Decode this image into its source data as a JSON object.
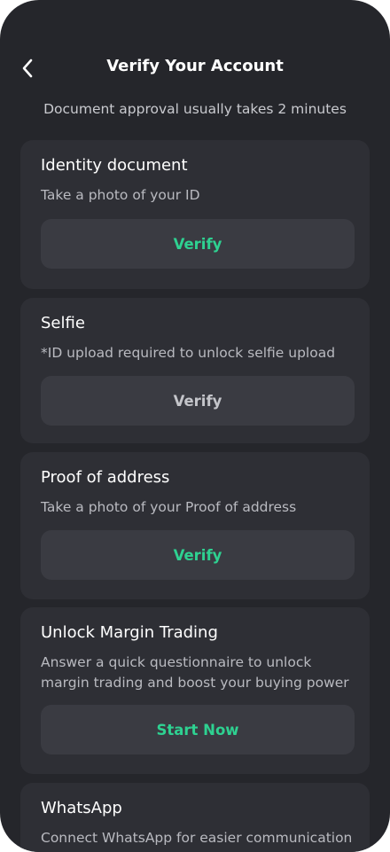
{
  "header": {
    "title": "Verify Your Account",
    "subtitle": "Document approval usually takes 2 minutes"
  },
  "colors": {
    "background": "#25262b",
    "card": "#2e2f35",
    "button": "#3a3b42",
    "accent": "#2ed191",
    "disabled": "#c4c5ca"
  },
  "cards": [
    {
      "title": "Identity document",
      "description": "Take a photo of your ID",
      "button_label": "Verify",
      "button_enabled": true
    },
    {
      "title": "Selfie",
      "description": "*ID upload required to unlock selfie upload",
      "button_label": "Verify",
      "button_enabled": false
    },
    {
      "title": "Proof of address",
      "description": "Take a photo of your Proof of address",
      "button_label": "Verify",
      "button_enabled": true
    },
    {
      "title": "Unlock Margin Trading",
      "description": "Answer a quick questionnaire to unlock margin trading and boost your buying power",
      "button_label": "Start Now",
      "button_enabled": true
    },
    {
      "title": "WhatsApp",
      "description": "Connect WhatsApp for easier communication"
    }
  ]
}
